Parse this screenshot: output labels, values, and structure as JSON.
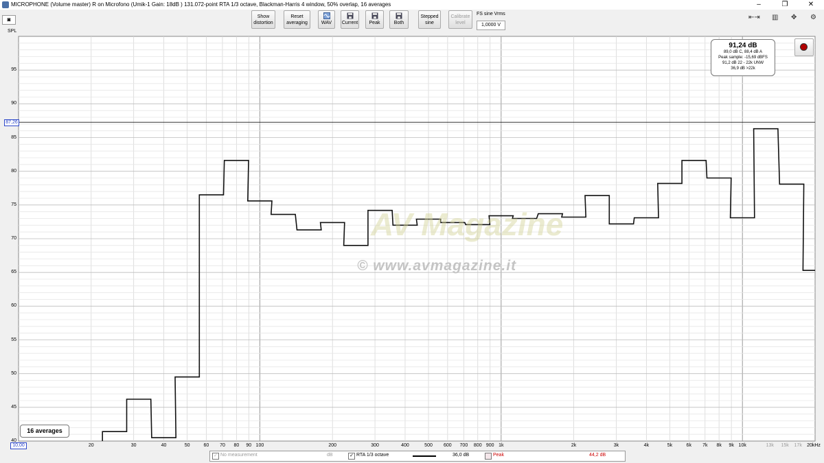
{
  "window": {
    "title": "MICROPHONE (Volume master) R on Microfono (Umik-1  Gain: 18dB  ) 131.072-point RTA 1/3 octave, Blackman-Harris 4 window, 50% overlap, 16 averages",
    "controls": [
      "–",
      "❐",
      "✕"
    ]
  },
  "toolbar": {
    "show_distortion": "Show distortion",
    "reset_averaging": "Reset averaging",
    "wav": "WAV",
    "current": "Current",
    "peak": "Peak",
    "both": "Both",
    "stepped_sine": "Stepped sine",
    "calibrate_level": "Calibrate level",
    "fs_label": "FS sine Vrms",
    "fs_value": "1,0000 V"
  },
  "plot": {
    "ylabel": "SPL",
    "y_cursor": "87,26",
    "x_cursor": "10,00",
    "readout": {
      "main": "91,24 dB",
      "lines": [
        "89,0 dB C, 88,4 dB A",
        "Peak sample: -15,69 dBFS",
        "91,2 dB 22 - 22k UNW",
        "36,9 dB >22k"
      ]
    },
    "averages_label": "16 averages",
    "watermark_url": "© www.avmagazine.it",
    "watermark_logo": "AV Magazine"
  },
  "legend": {
    "no_measurement": "No measurement",
    "no_measurement_value": "dB",
    "rta_label": "RTA 1/3 octave",
    "rta_value": "36,0 dB",
    "peak_label": "Peak",
    "peak_value": "44,2 dB",
    "peak_color": "#cc0000"
  },
  "chart_data": {
    "type": "line",
    "ylabel": "SPL",
    "xscale": "log",
    "xlim": [
      10,
      20000
    ],
    "ylim": [
      40,
      100
    ],
    "grid": true,
    "y_ticks": [
      40,
      45,
      50,
      55,
      60,
      65,
      70,
      75,
      80,
      85,
      90,
      95
    ],
    "y_tick_labels": [
      "40",
      "45",
      "50",
      "55",
      "60",
      "65",
      "70",
      "75",
      "80",
      "85",
      "90",
      "95"
    ],
    "x_ticks": [
      20,
      30,
      40,
      50,
      60,
      70,
      80,
      90,
      100,
      200,
      300,
      400,
      500,
      600,
      700,
      800,
      900,
      1000,
      2000,
      3000,
      4000,
      5000,
      6000,
      7000,
      8000,
      9000,
      10000,
      13000,
      15000,
      17000,
      20000
    ],
    "x_tick_labels": [
      "20",
      "30",
      "40",
      "50",
      "60",
      "70",
      "80",
      "90",
      "100",
      "200",
      "300",
      "400",
      "500",
      "600",
      "700",
      "800",
      "900",
      "1k",
      "2k",
      "3k",
      "4k",
      "5k",
      "6k",
      "7k",
      "8k",
      "9k",
      "10k",
      "13k",
      "15k",
      "17k",
      "20kHz"
    ],
    "faded_x_labels": [
      "13k",
      "15k",
      "17k"
    ],
    "cursor_level": 87.26,
    "series": [
      {
        "name": "RTA 1/3 octave",
        "style": "1/3-octave steps",
        "x": [
          25,
          31.5,
          40,
          50,
          63,
          80,
          100,
          125,
          160,
          200,
          250,
          315,
          400,
          500,
          630,
          800,
          1000,
          1250,
          1600,
          2000,
          2500,
          3150,
          4000,
          5000,
          6300,
          8000,
          10000,
          12500,
          16000,
          20000
        ],
        "y": [
          41.4,
          46.2,
          40.5,
          49.5,
          76.5,
          81.6,
          75.6,
          73.6,
          71.3,
          72.4,
          69.0,
          74.2,
          72.0,
          72.9,
          72.4,
          72.1,
          73.4,
          73.0,
          73.7,
          73.2,
          76.4,
          72.2,
          73.1,
          78.2,
          81.6,
          79.0,
          73.1,
          86.3,
          78.1,
          65.3
        ]
      }
    ]
  }
}
